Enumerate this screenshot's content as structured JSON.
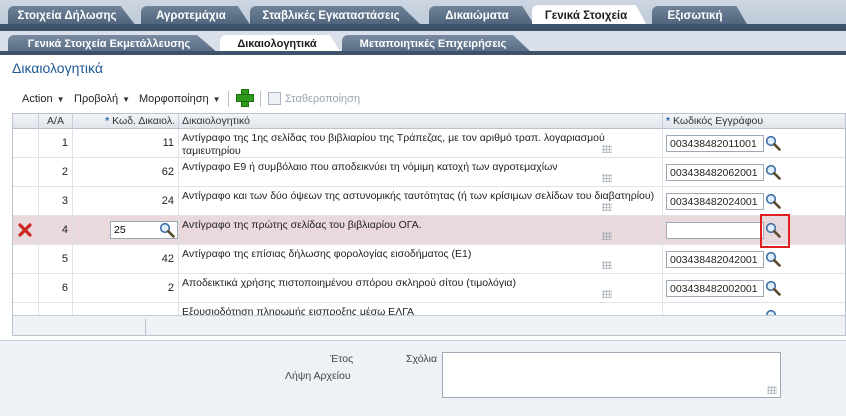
{
  "tabs_main": [
    {
      "label": "Στοιχεία Δήλωσης",
      "active": false
    },
    {
      "label": "Αγροτεμάχια",
      "active": false
    },
    {
      "label": "Σταβλικές Εγκαταστάσεις",
      "active": false
    },
    {
      "label": "Δικαιώματα",
      "active": false
    },
    {
      "label": "Γενικά Στοιχεία",
      "active": true
    },
    {
      "label": "Εξισωτική",
      "active": false
    }
  ],
  "tabs_sub": [
    {
      "label": "Γενικά Στοιχεία Εκμετάλλευσης",
      "active": false
    },
    {
      "label": "Δικαιολογητικά",
      "active": true
    },
    {
      "label": "Μεταποιητικές Επιχειρήσεις",
      "active": false
    }
  ],
  "page_title": "Δικαιολογητικά",
  "toolbar": {
    "action": "Action",
    "view": "Προβολή",
    "format": "Μορφοποίηση",
    "freeze": "Σταθεροποίηση"
  },
  "table": {
    "headers": {
      "aa": "Α/Α",
      "code_req": "*",
      "code": "Κωδ. Δικαιολ.",
      "desc": "Δικαιολογητικό",
      "doc_req": "*",
      "doc": "Κωδικός Εγγράφου"
    },
    "rows": [
      {
        "aa": "1",
        "code": "11",
        "desc": "Αντίγραφο της 1ης σελίδας του βιβλιαρίου της Τράπεζας, με τον αριθμό τραπ. λογαριασμού ταμιευτηρίου",
        "doc": "003438482011001"
      },
      {
        "aa": "2",
        "code": "62",
        "desc": "Αντίγραφο Ε9 ή συμβόλαιο που αποδεικνύει τη νόμιμη κατοχή των αγροτεμαχίων",
        "doc": "003438482062001"
      },
      {
        "aa": "3",
        "code": "24",
        "desc": "Αντίγραφο  και των δύο όψεων της αστυνομικής ταυτότητας (ή των κρίσιμων σελίδων του διαβατηρίου)",
        "doc": "003438482024001"
      },
      {
        "aa": "4",
        "code": "25",
        "desc": "Αντίγραφο  της πρώτης σελίδας του βιβλιαρίου ΟΓΑ.",
        "doc": ""
      },
      {
        "aa": "5",
        "code": "42",
        "desc": "Αντίγραφο της επίσιας δήλωσης φορολογίας εισοδήματος (Ε1)",
        "doc": "003438482042001"
      },
      {
        "aa": "6",
        "code": "2",
        "desc": "Αποδεικτικά χρήσης πιστοποιημένου σπόρου σκληρού σίτου (τιμολόγια)",
        "doc": "003438482002001"
      },
      {
        "aa": "",
        "code": "",
        "desc": "Εξουσιοδότηση πληρωμής εισπροξης μέσω ΕΛΓΑ",
        "doc": ""
      }
    ]
  },
  "bottom": {
    "year_label": "Έτος",
    "comments_label": "Σχόλια",
    "file_label": "Λήψη Αρχείου"
  }
}
